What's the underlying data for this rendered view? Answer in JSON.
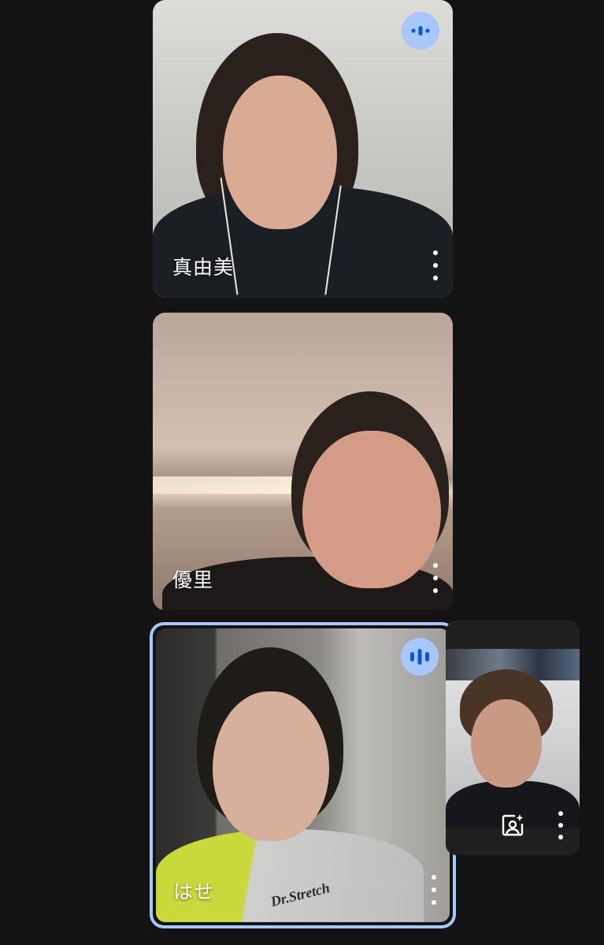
{
  "participants": [
    {
      "name": "真由美",
      "speaking": true
    },
    {
      "name": "優里",
      "speaking": false
    },
    {
      "name": "はせ",
      "speaking": true,
      "active_speaker": true
    }
  ],
  "self_view": {
    "icons": [
      "visual-effects-icon",
      "more-options-icon"
    ]
  },
  "colors": {
    "background": "#131313",
    "accent": "#a8c7fa",
    "speaking_glyph": "#0b57d0"
  },
  "icons": {
    "speaking": "audio-level-icon",
    "more": "more-vertical-icon"
  }
}
